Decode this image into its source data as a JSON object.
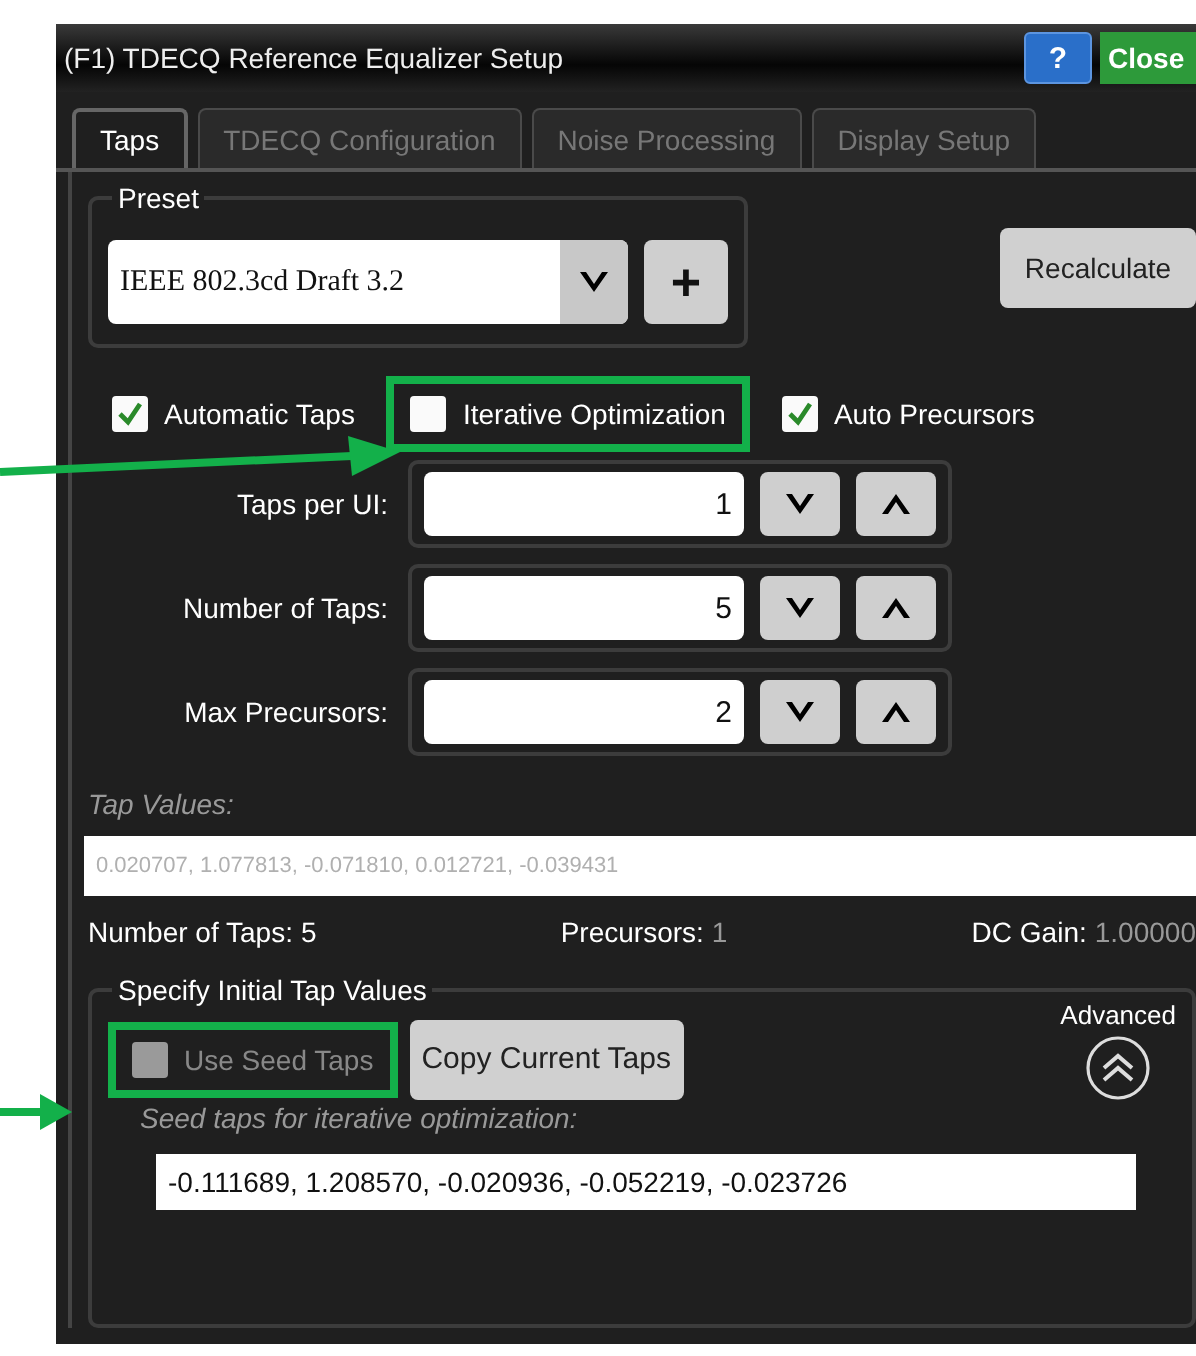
{
  "window": {
    "title": "(F1) TDECQ Reference Equalizer Setup",
    "help_button": "?",
    "close_button": "Close"
  },
  "tabs": [
    {
      "label": "Taps",
      "selected": true
    },
    {
      "label": "TDECQ Configuration",
      "selected": false
    },
    {
      "label": "Noise Processing",
      "selected": false
    },
    {
      "label": "Display Setup",
      "selected": false
    }
  ],
  "preset": {
    "label": "Preset",
    "value": "IEEE 802.3cd Draft 3.2",
    "add_button": "+"
  },
  "recalculate_button": "Recalculate",
  "options": [
    {
      "label": "Automatic Taps",
      "checked": true,
      "highlighted": false
    },
    {
      "label": "Iterative Optimization",
      "checked": false,
      "highlighted": true
    },
    {
      "label": "Auto Precursors",
      "checked": true,
      "highlighted": false
    }
  ],
  "spinners": [
    {
      "label": "Taps per UI:",
      "value": "1"
    },
    {
      "label": "Number of Taps:",
      "value": "5"
    },
    {
      "label": "Max Precursors:",
      "value": "2"
    }
  ],
  "tap_values": {
    "label": "Tap Values:",
    "value": "0.020707, 1.077813, -0.071810, 0.012721, -0.039431",
    "disabled": true
  },
  "summary": [
    {
      "label": "Number of Taps:",
      "value": "5",
      "dimmed": false
    },
    {
      "label": "Precursors:",
      "value": "1",
      "dimmed": true
    },
    {
      "label": "DC Gain:",
      "value": "1.00000",
      "dimmed": true
    }
  ],
  "seed": {
    "title": "Specify Initial Tap Values",
    "use_seed": {
      "label": "Use Seed Taps",
      "checked": false,
      "disabled": true,
      "highlighted": true
    },
    "copy_button": "Copy Current Taps",
    "advanced_label": "Advanced",
    "expanded": true,
    "seed_label": "Seed taps for iterative optimization:",
    "seed_value": "-0.111689, 1.208570, -0.020936, -0.052219, -0.023726"
  }
}
